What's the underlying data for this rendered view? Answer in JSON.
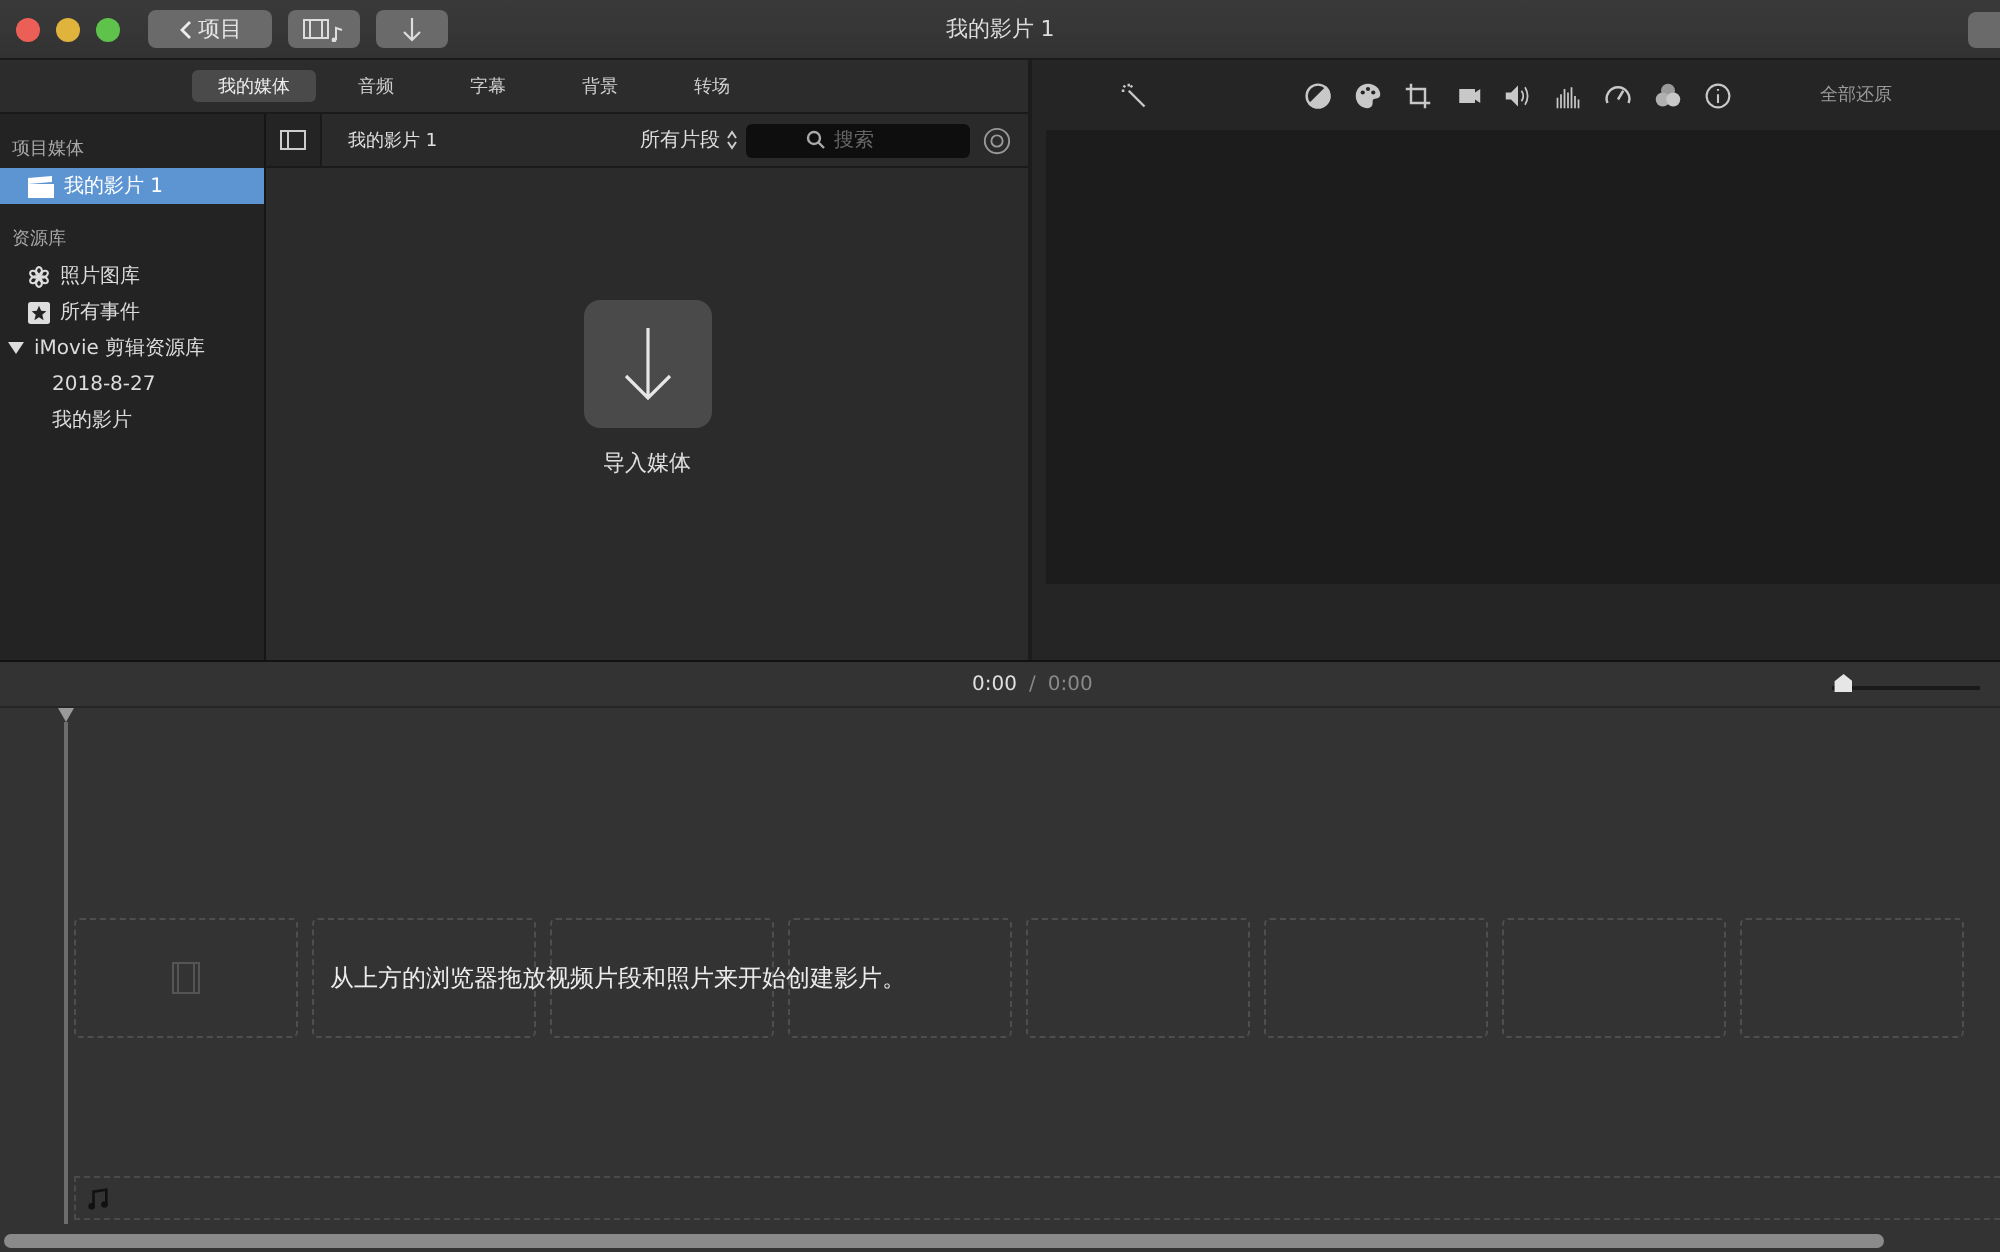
{
  "window": {
    "title": "我的影片 1"
  },
  "toolbar": {
    "back_button": "项目"
  },
  "tabs": [
    {
      "label": "我的媒体",
      "selected": true
    },
    {
      "label": "音频",
      "selected": false
    },
    {
      "label": "字幕",
      "selected": false
    },
    {
      "label": "背景",
      "selected": false
    },
    {
      "label": "转场",
      "selected": false
    }
  ],
  "sidebar": {
    "sections": [
      {
        "title": "项目媒体",
        "items": [
          {
            "label": "我的影片 1",
            "kind": "project",
            "selected": true
          }
        ]
      },
      {
        "title": "资源库",
        "items": [
          {
            "label": "照片图库",
            "kind": "photos",
            "selected": false
          },
          {
            "label": "所有事件",
            "kind": "events",
            "selected": false
          },
          {
            "label": "iMovie 剪辑资源库",
            "kind": "library",
            "selected": false,
            "expanded": true,
            "children": [
              {
                "label": "2018-8-27",
                "selected": false
              },
              {
                "label": "我的影片",
                "selected": false
              }
            ]
          }
        ]
      }
    ]
  },
  "browser": {
    "title": "我的影片 1",
    "filter": "所有片段",
    "search": {
      "placeholder": "搜索"
    },
    "import_label": "导入媒体"
  },
  "viewer": {
    "reset_all": "全部还原"
  },
  "timeline": {
    "current_time": "0:00",
    "separator": "/",
    "total_time": "0:00",
    "zoom": {
      "level": 0.02
    },
    "hint": "从上方的浏览器拖放视频片段和照片来开始创建影片。"
  }
}
